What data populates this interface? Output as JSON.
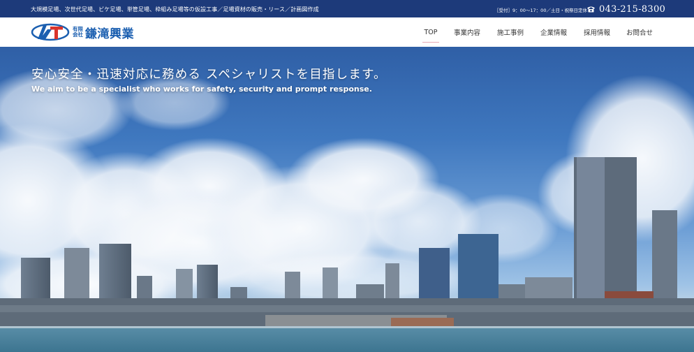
{
  "topbar": {
    "services": "大規模足場、次世代足場、ビケ足場、単管足場、枠組み足場等の仮設工事／足場資材の販売・リース／計画図作成",
    "hours": "［受付］9：00〜17：00／土日・祝祭日定休",
    "phone": "043-215-8300"
  },
  "logo": {
    "kind_top": "有限",
    "kind_bottom": "会社",
    "name": "鎌滝興業"
  },
  "nav": {
    "items": [
      {
        "label": "TOP",
        "active": true
      },
      {
        "label": "事業内容"
      },
      {
        "label": "施工事例"
      },
      {
        "label": "企業情報"
      },
      {
        "label": "採用情報"
      },
      {
        "label": "お問合せ"
      }
    ]
  },
  "hero": {
    "title": "安心安全・迅速対応に務める スペシャリストを目指します。",
    "subtitle": "We aim to be a specialist who works for safety, security and prompt response."
  },
  "colors": {
    "topbar": "#1d3a7a",
    "brand": "#1b5fb0",
    "logo_red": "#d9342b",
    "nav_active_underline": "#e7a9b5"
  }
}
